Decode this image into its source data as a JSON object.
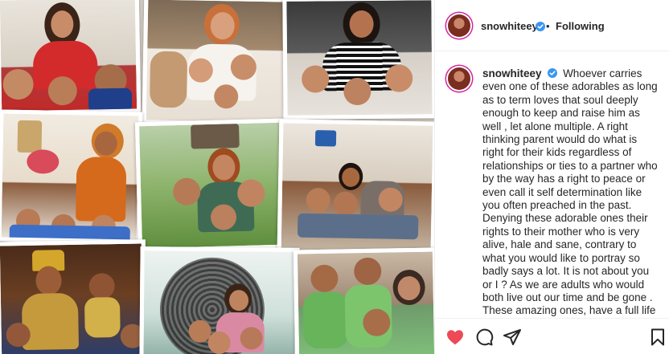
{
  "post": {
    "username": "snowhiteey",
    "verified": true,
    "follow_status": "Following",
    "separator": "•",
    "caption": "Whoever carries even one of these adorables as long as to term loves that soul deeply enough to keep and raise him as well , let alone multiple. A right thinking parent would do what is right for their kids regardless of relationships or ties to a partner who by the way has a right to peace or even call it self determination like you often preached in the past. Denying these adorable ones their rights to their mother who is very alive, hale and sane, contrary to what you would like to portray so badly says a lot. It is not about you or I ? As we are adults who would both live out our time and be gone . These amazing ones, have a full life"
  },
  "actions": {
    "like_icon": "heart-filled-icon",
    "comment_icon": "comment-icon",
    "share_icon": "paper-plane-icon",
    "save_icon": "bookmark-icon",
    "like_color": "#ed4956"
  },
  "colors": {
    "verified_blue": "#3897f0",
    "text": "#262626",
    "border": "#efefef"
  }
}
